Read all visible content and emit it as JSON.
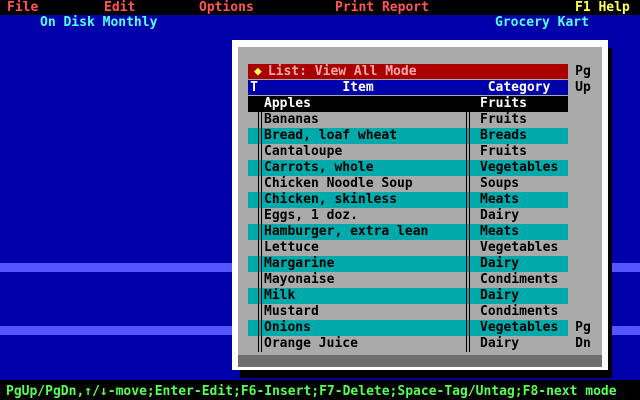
{
  "menu": {
    "file": "File",
    "edit": "Edit",
    "options": "Options",
    "print_report": "Print Report",
    "help": "F1 Help"
  },
  "subtitle": {
    "left": "On Disk Monthly",
    "right": "Grocery Kart"
  },
  "window": {
    "title_glyph": "◆",
    "title": "List: View All Mode",
    "header_tag": "T",
    "header_item": "Item",
    "header_category": "Category",
    "pg_up": [
      "Pg",
      "Up"
    ],
    "pg_dn": [
      "Pg",
      "Dn"
    ]
  },
  "rows": [
    {
      "item": "Apples",
      "category": "Fruits"
    },
    {
      "item": "Bananas",
      "category": "Fruits"
    },
    {
      "item": "Bread, loaf wheat",
      "category": "Breads"
    },
    {
      "item": "Cantaloupe",
      "category": "Fruits"
    },
    {
      "item": "Carrots, whole",
      "category": "Vegetables"
    },
    {
      "item": "Chicken Noodle Soup",
      "category": "Soups"
    },
    {
      "item": "Chicken, skinless",
      "category": "Meats"
    },
    {
      "item": "Eggs, 1 doz.",
      "category": "Dairy"
    },
    {
      "item": "Hamburger, extra lean",
      "category": "Meats"
    },
    {
      "item": "Lettuce",
      "category": "Vegetables"
    },
    {
      "item": "Margarine",
      "category": "Dairy"
    },
    {
      "item": "Mayonaise",
      "category": "Condiments"
    },
    {
      "item": "Milk",
      "category": "Dairy"
    },
    {
      "item": "Mustard",
      "category": "Condiments"
    },
    {
      "item": "Onions",
      "category": "Vegetables"
    },
    {
      "item": "Orange Juice",
      "category": "Dairy"
    }
  ],
  "selected_index": 0,
  "status": {
    "pgup_pgdn": "PgUp/PgDn,",
    "move": "↑/↓-move;",
    "enter_edit": "Enter-Edit;",
    "f6_insert": "F6-Insert;",
    "f7_delete": "F7-Delete;",
    "space_tag": "Space-Tag/Untag;",
    "f8_next_mode": "F8-next mode"
  },
  "colors": {
    "desktop": "#0000aa",
    "menu_text": "#ff5555",
    "help_text": "#ffff55",
    "subtitle_text": "#55ffff",
    "title_bar": "#aa0000",
    "row_alt": "#00aaaa",
    "status_key": "#55ff55"
  }
}
